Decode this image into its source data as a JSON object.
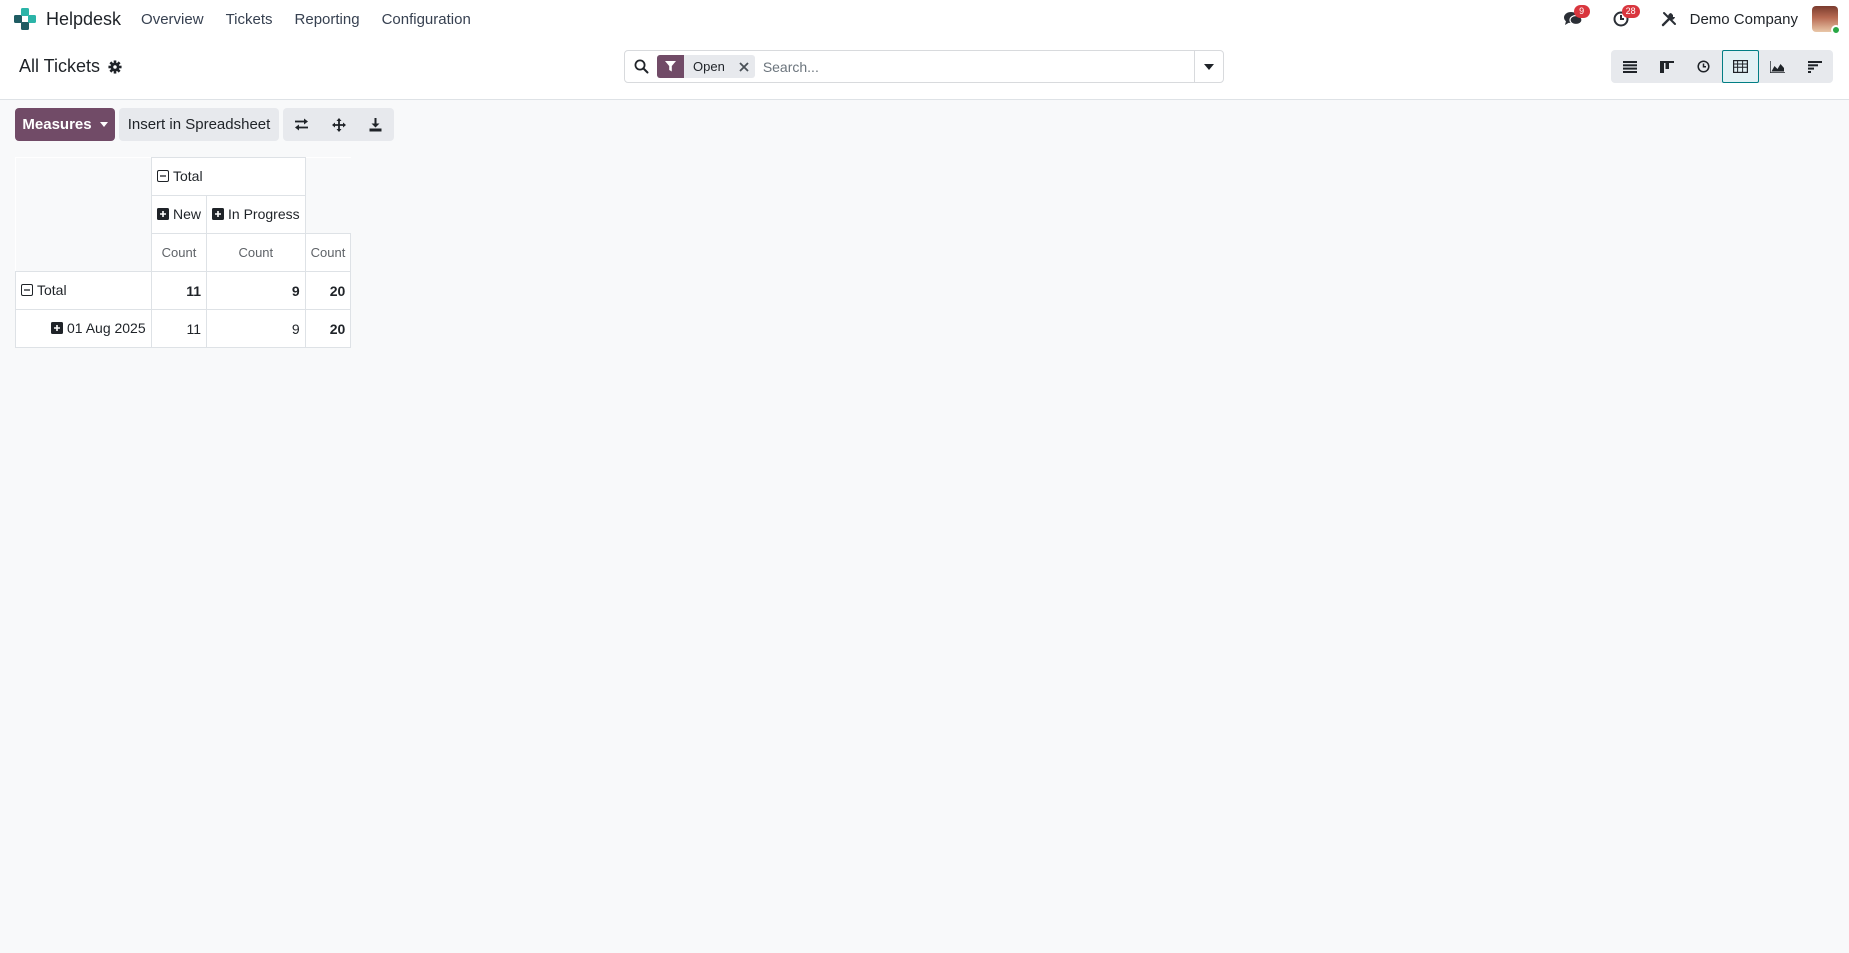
{
  "app": {
    "name": "Helpdesk",
    "menu": [
      "Overview",
      "Tickets",
      "Reporting",
      "Configuration"
    ]
  },
  "systray": {
    "messages_count": "9",
    "activities_count": "28",
    "company": "Demo Company"
  },
  "control_panel": {
    "title": "All Tickets",
    "facet_label": "Open",
    "search_placeholder": "Search...",
    "views": [
      "list",
      "kanban",
      "activity",
      "pivot",
      "graph",
      "cohort"
    ],
    "active_view": "pivot"
  },
  "toolbar": {
    "measures_label": "Measures",
    "spreadsheet_label": "Insert in Spreadsheet"
  },
  "pivot": {
    "col_header_total": "Total",
    "col_groups": [
      "New",
      "In Progress"
    ],
    "measure": "Count",
    "rows": [
      {
        "label": "Total",
        "values": [
          "11",
          "9",
          "20"
        ]
      },
      {
        "label": "01 Aug 2025",
        "values": [
          "11",
          "9",
          "20"
        ]
      }
    ]
  },
  "colors": {
    "brand": "#714b67",
    "accent": "#017e84",
    "badge": "#d9363e"
  }
}
